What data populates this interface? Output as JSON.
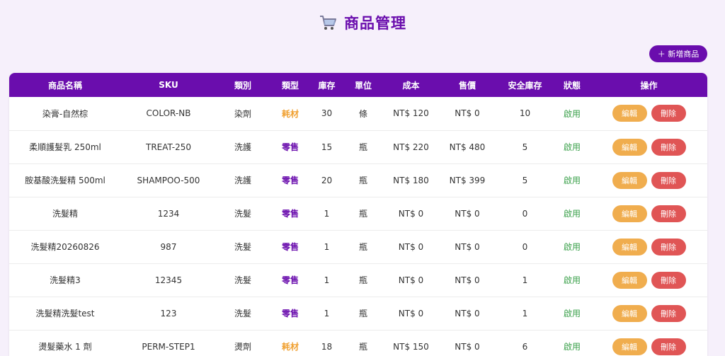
{
  "header": {
    "title": "商品管理",
    "icon": "shopping-cart-icon"
  },
  "toolbar": {
    "add_label": "＋ 新增商品"
  },
  "table": {
    "columns": [
      "商品名稱",
      "SKU",
      "類別",
      "類型",
      "庫存",
      "單位",
      "成本",
      "售價",
      "安全庫存",
      "狀態",
      "操作"
    ],
    "edit_label": "編輯",
    "delete_label": "刪除",
    "rows": [
      {
        "name": "染膏-自然棕",
        "sku": "COLOR-NB",
        "category": "染劑",
        "type": "耗材",
        "type_kind": "consumable",
        "stock": "30",
        "unit": "條",
        "cost": "NT$ 120",
        "price": "NT$ 0",
        "safety": "10",
        "status": "啟用"
      },
      {
        "name": "柔順護髮乳 250ml",
        "sku": "TREAT-250",
        "category": "洗護",
        "type": "零售",
        "type_kind": "retail",
        "stock": "15",
        "unit": "瓶",
        "cost": "NT$ 220",
        "price": "NT$ 480",
        "safety": "5",
        "status": "啟用"
      },
      {
        "name": "胺基酸洗髮精 500ml",
        "sku": "SHAMPOO-500",
        "category": "洗護",
        "type": "零售",
        "type_kind": "retail",
        "stock": "20",
        "unit": "瓶",
        "cost": "NT$ 180",
        "price": "NT$ 399",
        "safety": "5",
        "status": "啟用"
      },
      {
        "name": "洗髮精",
        "sku": "1234",
        "category": "洗髮",
        "type": "零售",
        "type_kind": "retail",
        "stock": "1",
        "unit": "瓶",
        "cost": "NT$ 0",
        "price": "NT$ 0",
        "safety": "0",
        "status": "啟用"
      },
      {
        "name": "洗髮精20260826",
        "sku": "987",
        "category": "洗髮",
        "type": "零售",
        "type_kind": "retail",
        "stock": "1",
        "unit": "瓶",
        "cost": "NT$ 0",
        "price": "NT$ 0",
        "safety": "0",
        "status": "啟用"
      },
      {
        "name": "洗髮精3",
        "sku": "12345",
        "category": "洗髮",
        "type": "零售",
        "type_kind": "retail",
        "stock": "1",
        "unit": "瓶",
        "cost": "NT$ 0",
        "price": "NT$ 0",
        "safety": "1",
        "status": "啟用"
      },
      {
        "name": "洗髮精洗髮test",
        "sku": "123",
        "category": "洗髮",
        "type": "零售",
        "type_kind": "retail",
        "stock": "1",
        "unit": "瓶",
        "cost": "NT$ 0",
        "price": "NT$ 0",
        "safety": "1",
        "status": "啟用"
      },
      {
        "name": "燙髮藥水 1 劑",
        "sku": "PERM-STEP1",
        "category": "燙劑",
        "type": "耗材",
        "type_kind": "consumable",
        "stock": "18",
        "unit": "瓶",
        "cost": "NT$ 150",
        "price": "NT$ 0",
        "safety": "6",
        "status": "啟用"
      }
    ]
  },
  "colors": {
    "accent": "#6a0dad",
    "edit": "#f0ad4e",
    "delete": "#e05555",
    "active": "#3aa04a",
    "consumable": "#f0a030",
    "background": "#f6f0fb"
  }
}
